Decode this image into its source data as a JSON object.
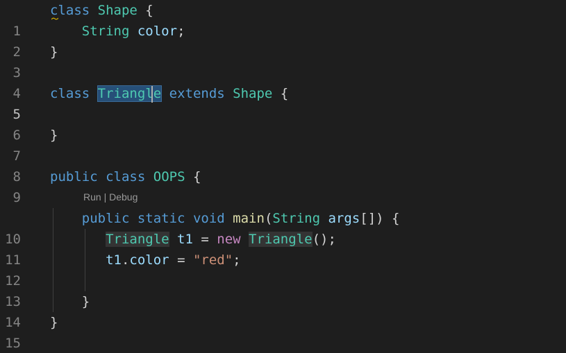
{
  "editor": {
    "line_numbers": [
      "1",
      "2",
      "3",
      "4",
      "5",
      "6",
      "7",
      "8",
      "9",
      "10",
      "11",
      "12",
      "13",
      "14",
      "15"
    ],
    "codelens": {
      "run": "Run",
      "sep": " | ",
      "debug": "Debug"
    },
    "tokens": {
      "l1_class": "class",
      "l1_shape": "Shape",
      "l1_brace": " {",
      "l2_string": "String",
      "l2_color": "color",
      "l2_semi": ";",
      "l3_close": "}",
      "l5_class": "class",
      "l5_triangle": "Triangle",
      "l5_extends": "extends",
      "l5_shape": "Shape",
      "l5_brace": " {",
      "l7_close": "}",
      "l9_public": "public",
      "l9_class": "class",
      "l9_oops": "OOPS",
      "l9_brace": " {",
      "l10_public": "public",
      "l10_static": "static",
      "l10_void": "void",
      "l10_main": "main",
      "l10_paren": "(",
      "l10_string": "String",
      "l10_args": "args",
      "l10_rest": "[]) {",
      "l11_triangle": "Triangle",
      "l11_t1": "t1",
      "l11_eq": " = ",
      "l11_new": "new",
      "l11_triangle2": "Triangle",
      "l11_rest": "();",
      "l12_t1": "t1",
      "l12_dot": ".",
      "l12_color": "color",
      "l12_eq": " = ",
      "l12_str": "\"red\"",
      "l12_semi": ";",
      "l14_close": "}",
      "l15_close": "}"
    }
  },
  "colors": {
    "background": "#1e1e1e",
    "keyword": "#569cd6",
    "control_keyword": "#c586c0",
    "type": "#4ec9b0",
    "variable": "#9cdcfe",
    "function": "#dcdcaa",
    "string": "#ce9178",
    "selection": "#264f78",
    "line_number": "#858585"
  }
}
